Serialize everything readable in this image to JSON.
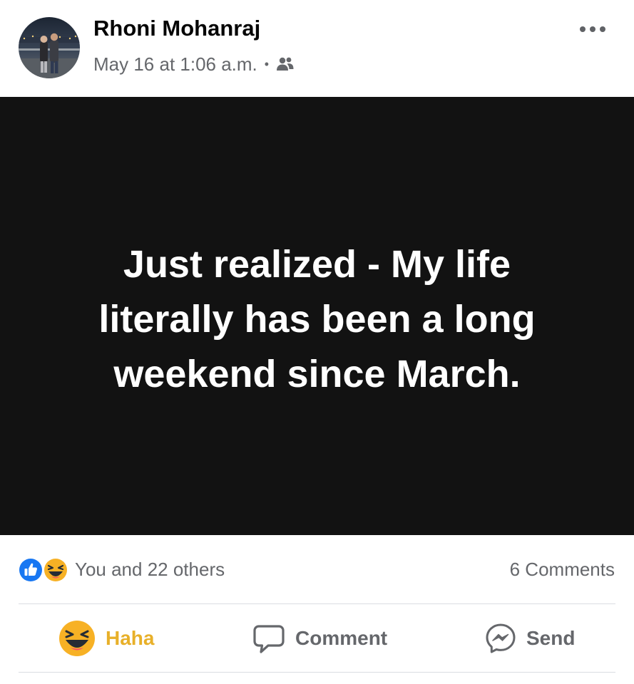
{
  "post": {
    "author_name": "Rhoni Mohanraj",
    "timestamp": "May 16 at 1:06 a.m.",
    "separator": "•",
    "audience_icon": "friends-icon",
    "more_icon": "more-horizontal-icon",
    "content_text": "Just realized - My life literally has been a long weekend since March.",
    "content_background": "#121212"
  },
  "reactions": {
    "icons": [
      "like-reaction-icon",
      "haha-reaction-icon"
    ],
    "summary": "You and 22 others",
    "comments_count": "6 Comments"
  },
  "actions": {
    "reaction_label": "Haha",
    "reaction_icon": "haha-reaction-icon",
    "comment_label": "Comment",
    "comment_icon": "comment-bubble-icon",
    "send_label": "Send",
    "send_icon": "messenger-icon"
  },
  "colors": {
    "like_blue": "#1877f2",
    "haha_yellow": "#f7b125",
    "haha_label": "#e8b029",
    "secondary_text": "#65676b"
  }
}
